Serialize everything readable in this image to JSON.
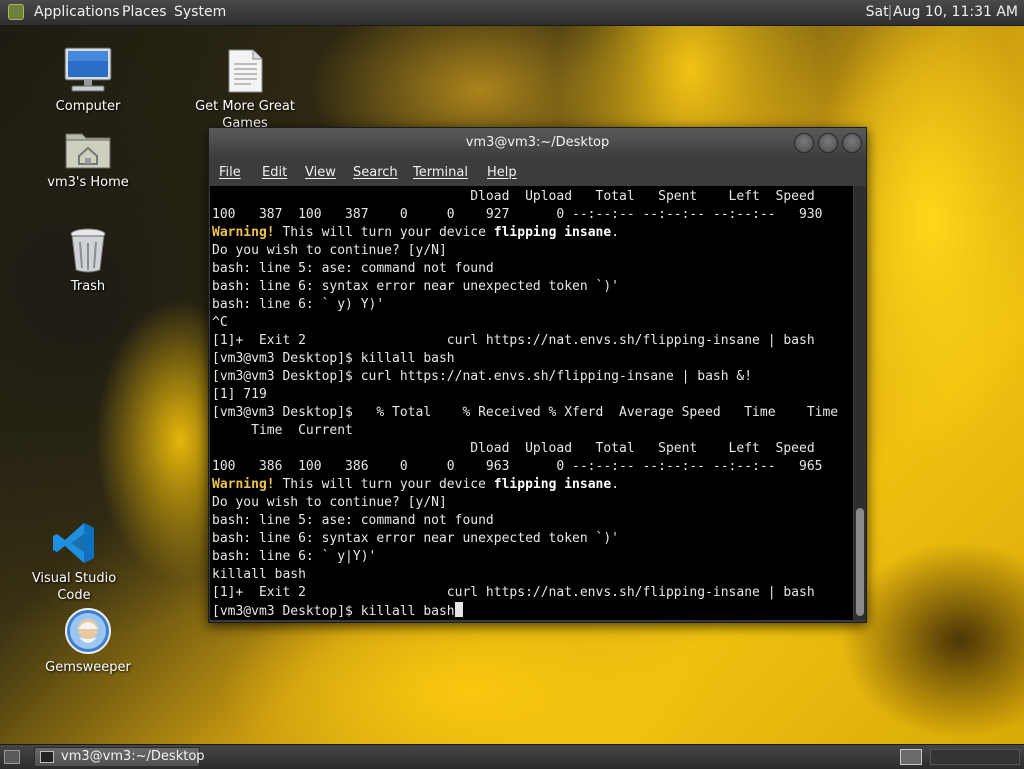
{
  "top_panel": {
    "menus": [
      "Applications",
      "Places",
      "System"
    ],
    "clock": "Sat Aug 10, 11:31 AM"
  },
  "desktop_icons": {
    "computer": "Computer",
    "get_more_games": "Get More Great Games",
    "home": "vm3's Home",
    "trash": "Trash",
    "vscode": "Visual Studio Code",
    "gemsweeper": "Gemsweeper"
  },
  "terminal": {
    "title": "vm3@vm3:~/Desktop",
    "menu": [
      "File",
      "Edit",
      "View",
      "Search",
      "Terminal",
      "Help"
    ],
    "lines": [
      [
        {
          "t": "                                 Dload  Upload   Total   Spent    Left  Speed"
        }
      ],
      [
        {
          "t": "100   387  100   387    0     0    927      0 --:--:-- --:--:-- --:--:--   930"
        }
      ],
      [
        {
          "t": "Warning!",
          "c": "warn"
        },
        {
          "t": " This will turn your device "
        },
        {
          "t": "flipping insane",
          "c": "bold"
        },
        {
          "t": "."
        }
      ],
      [
        {
          "t": "Do you wish to continue? [y/N]"
        }
      ],
      [
        {
          "t": "bash: line 5: ase: command not found"
        }
      ],
      [
        {
          "t": "bash: line 6: syntax error near unexpected token `)'"
        }
      ],
      [
        {
          "t": "bash: line 6: ` y) Y)'"
        }
      ],
      [
        {
          "t": "^C"
        }
      ],
      [
        {
          "t": "[1]+  Exit 2                  curl https://nat.envs.sh/flipping-insane | bash"
        }
      ],
      [
        {
          "t": "[vm3@vm3 Desktop]$ killall bash"
        }
      ],
      [
        {
          "t": "[vm3@vm3 Desktop]$ curl https://nat.envs.sh/flipping-insane | bash &!"
        }
      ],
      [
        {
          "t": "[1] 719"
        }
      ],
      [
        {
          "t": "[vm3@vm3 Desktop]$   % Total    % Received % Xferd  Average Speed   Time    Time"
        }
      ],
      [
        {
          "t": "     Time  Current"
        }
      ],
      [
        {
          "t": "                                 Dload  Upload   Total   Spent    Left  Speed"
        }
      ],
      [
        {
          "t": "100   386  100   386    0     0    963      0 --:--:-- --:--:-- --:--:--   965"
        }
      ],
      [
        {
          "t": "Warning!",
          "c": "warn"
        },
        {
          "t": " This will turn your device "
        },
        {
          "t": "flipping insane",
          "c": "bold"
        },
        {
          "t": "."
        }
      ],
      [
        {
          "t": "Do you wish to continue? [y/N]"
        }
      ],
      [
        {
          "t": "bash: line 5: ase: command not found"
        }
      ],
      [
        {
          "t": "bash: line 6: syntax error near unexpected token `)'"
        }
      ],
      [
        {
          "t": "bash: line 6: ` y|Y)'"
        }
      ],
      [
        {
          "t": "killall bash"
        }
      ],
      [
        {
          "t": "[1]+  Exit 2                  curl https://nat.envs.sh/flipping-insane | bash"
        }
      ],
      [
        {
          "t": "[vm3@vm3 Desktop]$ killall bash"
        }
      ]
    ]
  },
  "taskbar": {
    "window_button": "vm3@vm3:~/Desktop"
  }
}
